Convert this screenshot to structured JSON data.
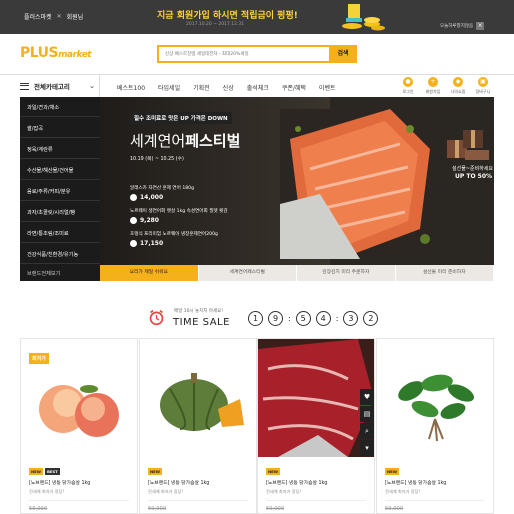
{
  "top_banner": {
    "left_a": "플러스마켓",
    "left_b": "회원님",
    "title": "지금 회원가입 하시면 적립금이 펑펑!",
    "date": "2017.10.20 ~ 2017.12.31",
    "close_label": "오늘하루열지않음"
  },
  "header": {
    "logo_a": "PLUS",
    "logo_b": "market",
    "search_placeholder": "신상 베스트친맹 세일데전자 - 최대20%세일",
    "search_button": "검색"
  },
  "nav": {
    "category_button": "전체카테고리",
    "menu": [
      "베스트100",
      "타임세일",
      "기획전",
      "신상",
      "출석체크",
      "쿠폰/혜택",
      "이벤트"
    ],
    "quick": [
      {
        "label": "로그인",
        "icon": "user-icon"
      },
      {
        "label": "회원가입",
        "icon": "signup-icon"
      },
      {
        "label": "나의쇼핑",
        "icon": "tag-icon"
      },
      {
        "label": "장바구니",
        "icon": "cart-icon"
      }
    ]
  },
  "categories": [
    "과일/견과/채소",
    "쌀/잡곡",
    "정육/계란류",
    "수산물/해산물/건어물",
    "음료/주류/커피/분유",
    "과자/초콜릿/시리얼/빵",
    "라면/통조림/조미료",
    "건강식품/친환경/유기농",
    "브랜드전체보기"
  ],
  "hero": {
    "badge": "필수 조미료로 맛은 UP 가격은 DOWN",
    "title_a": "세계연어",
    "title_b": "페스티벌",
    "date": "10.19 (목) ~ 10.25 (수)",
    "items": [
      {
        "name": "알래스카 자연산 훈제 연어 180g",
        "price": "14,000"
      },
      {
        "name": "노르웨이 생연어회 뱃살 1kg 속성연어회 필렛 횟감",
        "price": "9,280"
      },
      {
        "name": "호랭식 프리미엄 노르웨이 냉장훈제연어200g",
        "price": "17,150"
      }
    ],
    "side_promo_a": "설선물~준비하세요",
    "side_promo_b": "UP TO 50%",
    "tabs": [
      "요리가 제일 쉬워요",
      "세계연어페스티벌",
      "김장김치 미리 주문하자",
      "설선물 미리 준비하자"
    ]
  },
  "timesale": {
    "subtitle": "매일 10시 놓치지 마세요!",
    "title": "TIME SALE",
    "digits": [
      "1",
      "9",
      "5",
      "4",
      "3",
      "2"
    ]
  },
  "products": [
    {
      "badge": "최저가",
      "tags": [
        "NEW",
        "BEST"
      ],
      "name": "[노브랜드] 냉동 닭가슴살 1kg",
      "desc": "전세계 최저가 정당!",
      "price": "59,000"
    },
    {
      "badge": "",
      "tags": [
        "NEW"
      ],
      "name": "[노브랜드] 냉동 닭가슴살 1kg",
      "desc": "전세계 최저가 정당!",
      "price": "59,000"
    },
    {
      "badge": "",
      "tags": [
        "NEW"
      ],
      "name": "[노브랜드] 냉동 닭가슴살 1kg",
      "desc": "전세계 최저가 정당!",
      "price": "59,000"
    },
    {
      "badge": "",
      "tags": [
        "NEW"
      ],
      "name": "[노브랜드] 냉동 닭가슴살 1kg",
      "desc": "전세계 최저가 정당!",
      "price": "59,000"
    }
  ],
  "colors": {
    "accent": "#f5b11a",
    "dark": "#1b1b1b",
    "banner": "#3a3a3a",
    "title_yellow": "#ffd23a"
  }
}
